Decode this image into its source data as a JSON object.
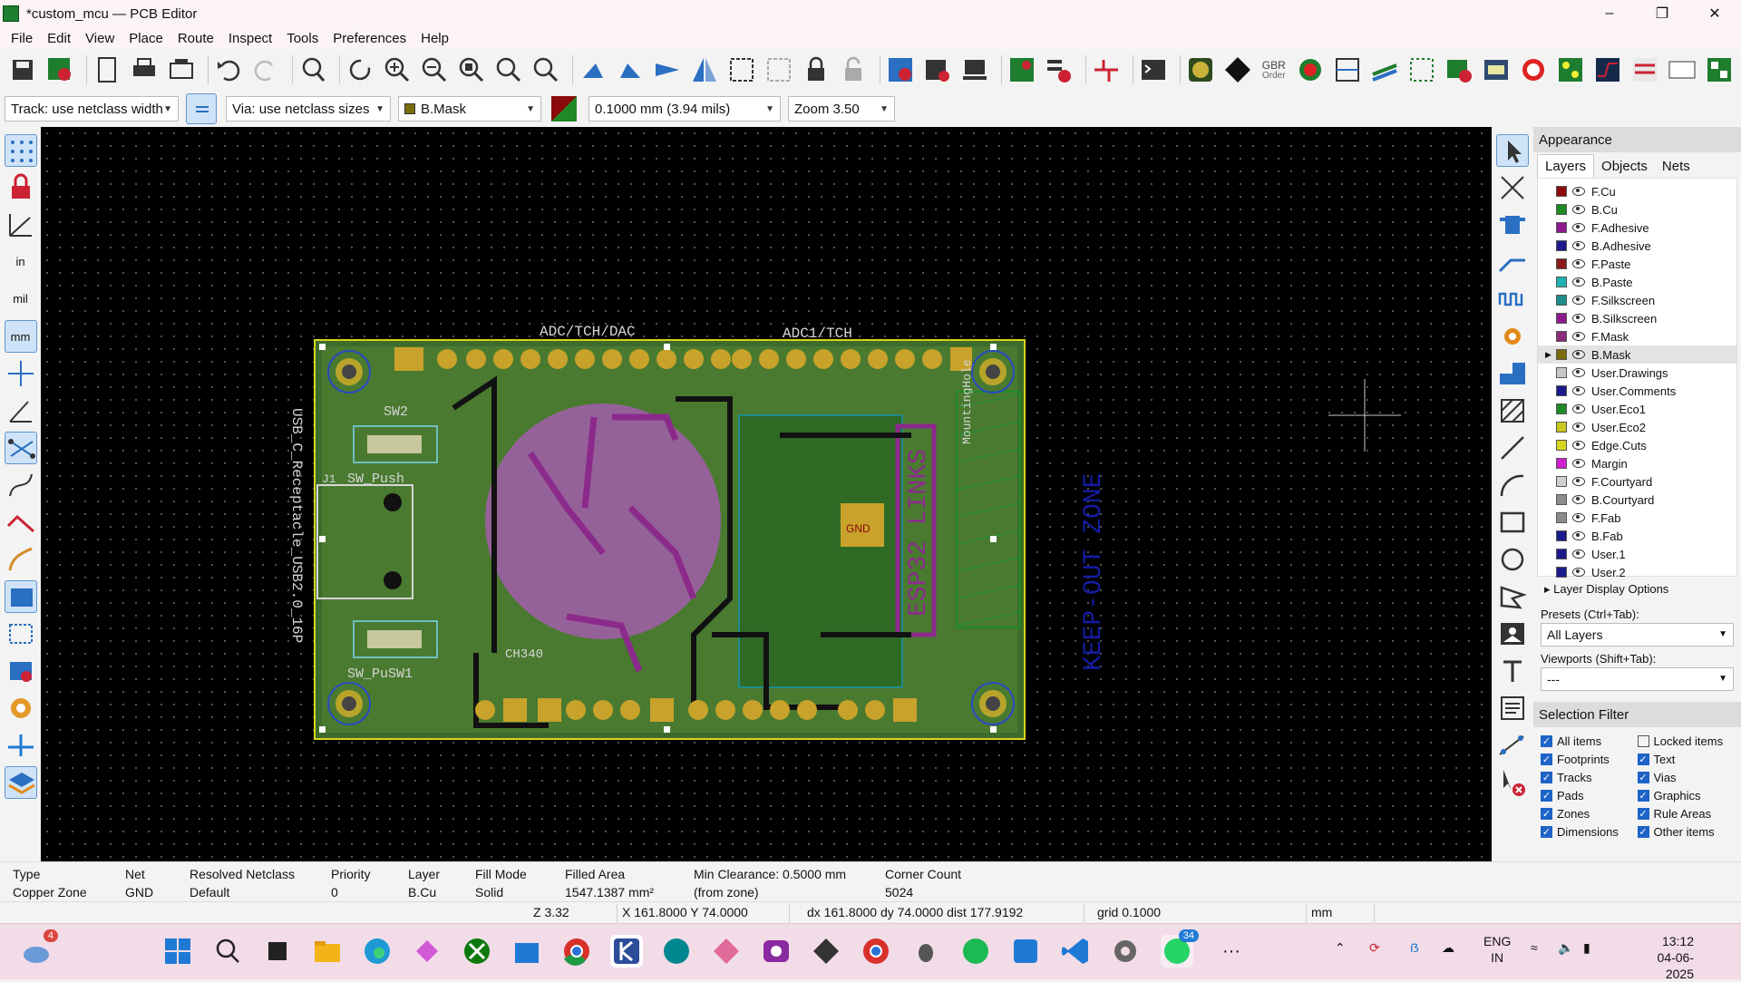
{
  "window": {
    "title": "*custom_mcu — PCB Editor",
    "min_icon": "minimize-icon",
    "max_icon": "restore-icon",
    "close_icon": "close-icon"
  },
  "menu": [
    "File",
    "Edit",
    "View",
    "Place",
    "Route",
    "Inspect",
    "Tools",
    "Preferences",
    "Help"
  ],
  "toolbar": {
    "gbr_order_label": "GBR",
    "gbr_order_sub": "Order"
  },
  "options": {
    "track": "Track: use netclass width",
    "via": "Via: use netclass sizes",
    "layer": "B.Mask",
    "grid": "0.1000 mm (3.94 mils)",
    "zoom": "Zoom 3.50"
  },
  "pcb": {
    "labels": {
      "adc_tch_dac": "ADC/TCH/DAC",
      "adc1_tch": "ADC1/TCH",
      "keepout": "KEEP-OUT ZONE",
      "usb_ref": "USB_C_Receptacle_USB2.0_16P",
      "sw2": "SW2",
      "sw_push": "SW_Push",
      "sw_push2": "SW_PuSW1",
      "j1": "J1",
      "ch340": "CH340",
      "mounting_hole": "MountingHole",
      "esp32": "ESP32 LINKS",
      "gnd": "GND"
    }
  },
  "appearance": {
    "title": "Appearance",
    "tabs": [
      "Layers",
      "Objects",
      "Nets"
    ],
    "layers": [
      {
        "name": "F.Cu",
        "color": "#8b0a0a"
      },
      {
        "name": "B.Cu",
        "color": "#1f8a25"
      },
      {
        "name": "F.Adhesive",
        "color": "#8c1a8c"
      },
      {
        "name": "B.Adhesive",
        "color": "#1a1a8a"
      },
      {
        "name": "F.Paste",
        "color": "#8a1a1a"
      },
      {
        "name": "B.Paste",
        "color": "#20b2b2"
      },
      {
        "name": "F.Silkscreen",
        "color": "#1e8c8c"
      },
      {
        "name": "B.Silkscreen",
        "color": "#8c1a8c"
      },
      {
        "name": "F.Mask",
        "color": "#8a2a7a"
      },
      {
        "name": "B.Mask",
        "color": "#7a6c0a"
      },
      {
        "name": "User.Drawings",
        "color": "#c8c8c8"
      },
      {
        "name": "User.Comments",
        "color": "#1a1a8a"
      },
      {
        "name": "User.Eco1",
        "color": "#1f8a25"
      },
      {
        "name": "User.Eco2",
        "color": "#c8c81e"
      },
      {
        "name": "Edge.Cuts",
        "color": "#d6d61e"
      },
      {
        "name": "Margin",
        "color": "#d01ed0"
      },
      {
        "name": "F.Courtyard",
        "color": "#cfcfcf"
      },
      {
        "name": "B.Courtyard",
        "color": "#8c8c8c"
      },
      {
        "name": "F.Fab",
        "color": "#8c8c8c"
      },
      {
        "name": "B.Fab",
        "color": "#1a1a8a"
      },
      {
        "name": "User.1",
        "color": "#1a1a8a"
      },
      {
        "name": "User.2",
        "color": "#1a1a8a"
      }
    ],
    "selected_layer": "B.Mask",
    "layer_display_options": "Layer Display Options",
    "presets_label": "Presets (Ctrl+Tab):",
    "presets_value": "All Layers",
    "viewports_label": "Viewports (Shift+Tab):",
    "viewports_value": "---",
    "selection_filter_title": "Selection Filter",
    "filters": [
      {
        "label": "All items",
        "checked": true
      },
      {
        "label": "Locked items",
        "checked": false
      },
      {
        "label": "Footprints",
        "checked": true
      },
      {
        "label": "Text",
        "checked": true
      },
      {
        "label": "Tracks",
        "checked": true
      },
      {
        "label": "Vias",
        "checked": true
      },
      {
        "label": "Pads",
        "checked": true
      },
      {
        "label": "Graphics",
        "checked": true
      },
      {
        "label": "Zones",
        "checked": true
      },
      {
        "label": "Rule Areas",
        "checked": true
      },
      {
        "label": "Dimensions",
        "checked": true
      },
      {
        "label": "Other items",
        "checked": true
      }
    ]
  },
  "info": {
    "cols": [
      {
        "head": "Type",
        "val": "Copper Zone"
      },
      {
        "head": "Net",
        "val": "GND"
      },
      {
        "head": "Resolved Netclass",
        "val": "Default"
      },
      {
        "head": "Priority",
        "val": "0"
      },
      {
        "head": "Layer",
        "val": "B.Cu"
      },
      {
        "head": "Fill Mode",
        "val": "Solid"
      },
      {
        "head": "Filled Area",
        "val": "1547.1387 mm²"
      },
      {
        "head": "Min Clearance: 0.5000 mm",
        "val": "(from zone)"
      },
      {
        "head": "Corner Count",
        "val": "5024"
      }
    ]
  },
  "status": {
    "z": "Z 3.32",
    "xy": "X 161.8000  Y 74.0000",
    "dxy": "dx 161.8000  dy 74.0000  dist 177.9192",
    "grid": "grid 0.1000",
    "units": "mm"
  },
  "taskbar": {
    "weather_badge": "4",
    "whatsapp_badge": "34",
    "lang1": "ENG",
    "lang2": "IN",
    "time": "13:12",
    "date": "04-06-2025",
    "more_icon": "···"
  }
}
